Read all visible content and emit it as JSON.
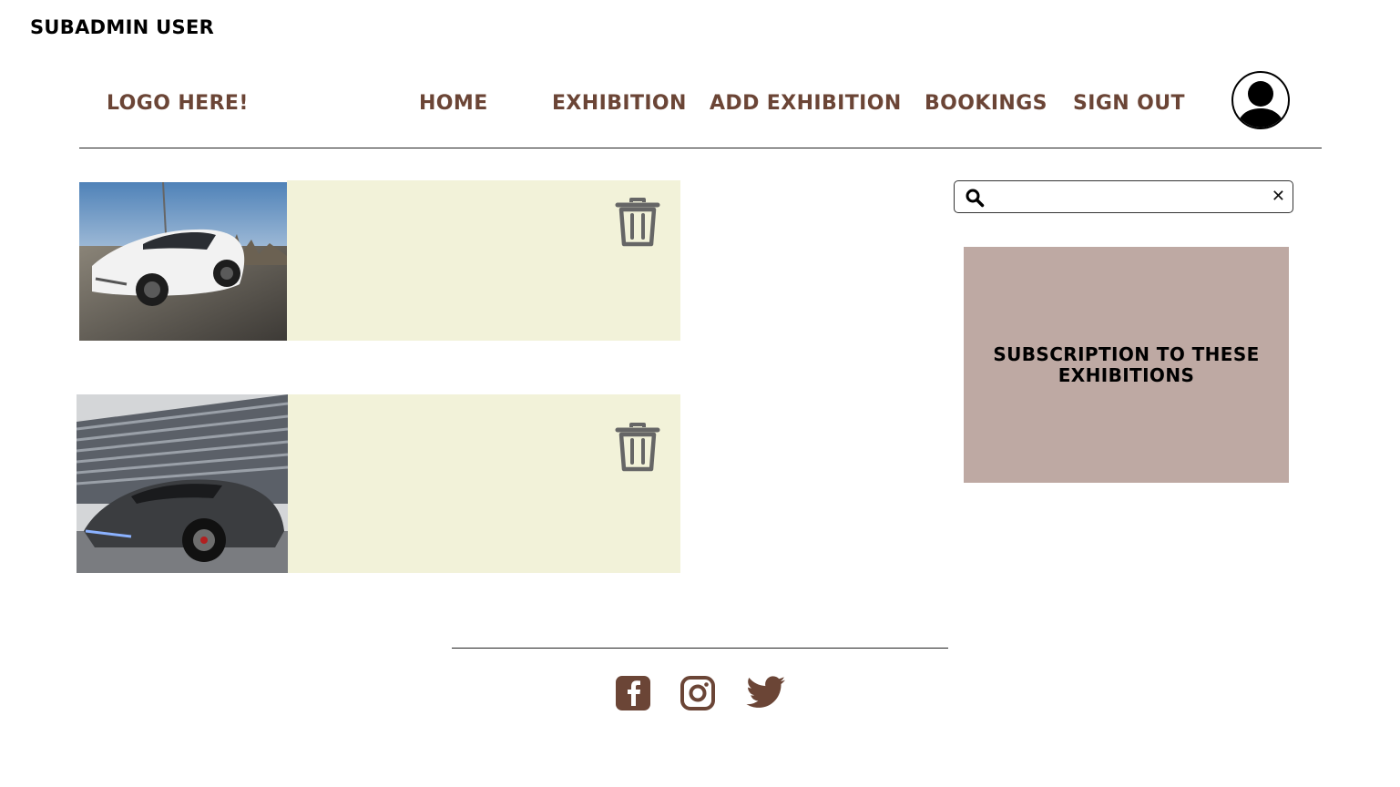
{
  "page": {
    "label": "SUBADMIN USER"
  },
  "nav": {
    "logo": "LOGO HERE!",
    "items": [
      "HOME",
      "EXHIBITION",
      "ADD EXHIBITION",
      "BOOKINGS",
      "SIGN OUT"
    ],
    "avatar_icon": "user-avatar-icon"
  },
  "cards": [
    {
      "image": "white-electric-sedan-photo",
      "delete_icon": "trash-icon"
    },
    {
      "image": "dark-supercar-photo",
      "delete_icon": "trash-icon"
    }
  ],
  "search": {
    "placeholder": "",
    "value": "",
    "clear_label": "✕"
  },
  "subscription": {
    "title": "SUBSCRIPTION TO THESE EXHIBITIONS"
  },
  "footer": {
    "social": [
      "facebook-icon",
      "instagram-icon",
      "twitter-icon"
    ]
  },
  "colors": {
    "nav_text": "#6b4536",
    "card_body": "#f2f2d9",
    "subscription_bg": "#bea9a3",
    "social_icon": "#6b4536"
  }
}
